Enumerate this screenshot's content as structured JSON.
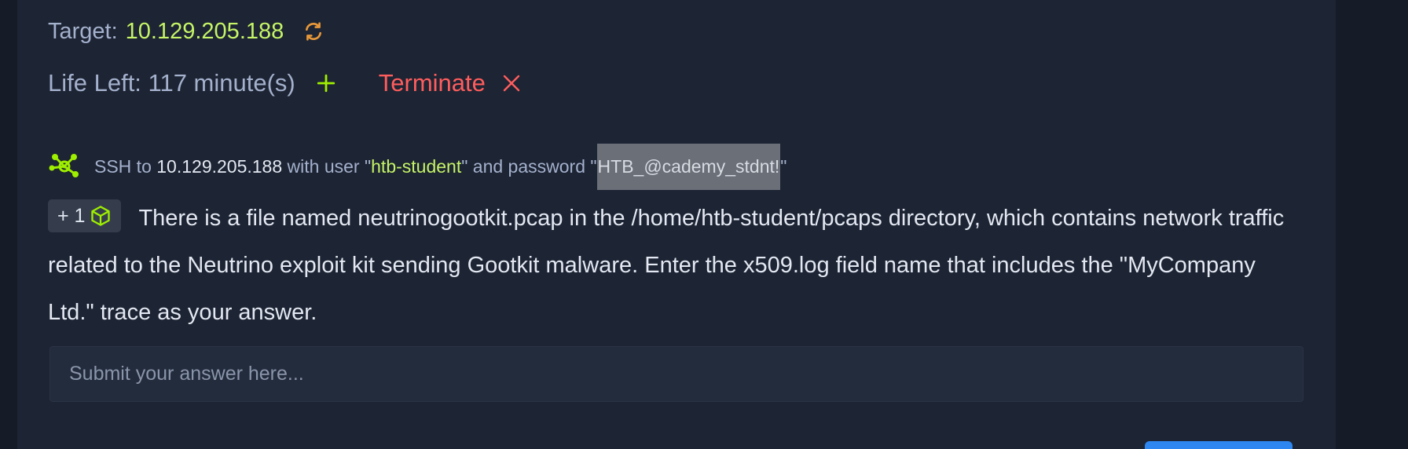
{
  "target": {
    "label": "Target:",
    "ip": "10.129.205.188"
  },
  "life": {
    "label": "Life Left: 117 minute(s)",
    "terminate_label": "Terminate"
  },
  "ssh": {
    "prefix": "SSH to ",
    "ip": "10.129.205.188",
    "with_user": " with user \"",
    "user": "htb-student",
    "and_password": "\" and password \"",
    "password": "HTB_@cademy_stdnt!",
    "suffix": "\""
  },
  "question": {
    "badge_label": "+ 1",
    "text": "There is a file named neutrinogootkit.pcap in the /home/htb-student/pcaps directory, which contains network traffic related to the Neutrino exploit kit sending Gootkit malware. Enter the x509.log field name that includes the \"MyCompany Ltd.\" trace as your answer."
  },
  "answer": {
    "placeholder": "Submit your answer here..."
  },
  "icons": {
    "refresh": "refresh-icon",
    "add_time": "plus-icon",
    "terminate": "close-icon",
    "ssh": "network-node-icon",
    "cube": "cube-icon"
  },
  "colors": {
    "accent_green": "#9fef00",
    "ip_green": "#c5f467",
    "danger": "#ff5d5d",
    "refresh_orange": "#e8983a",
    "card_bg": "#1d2433",
    "primary_blue": "#2e86f0"
  }
}
